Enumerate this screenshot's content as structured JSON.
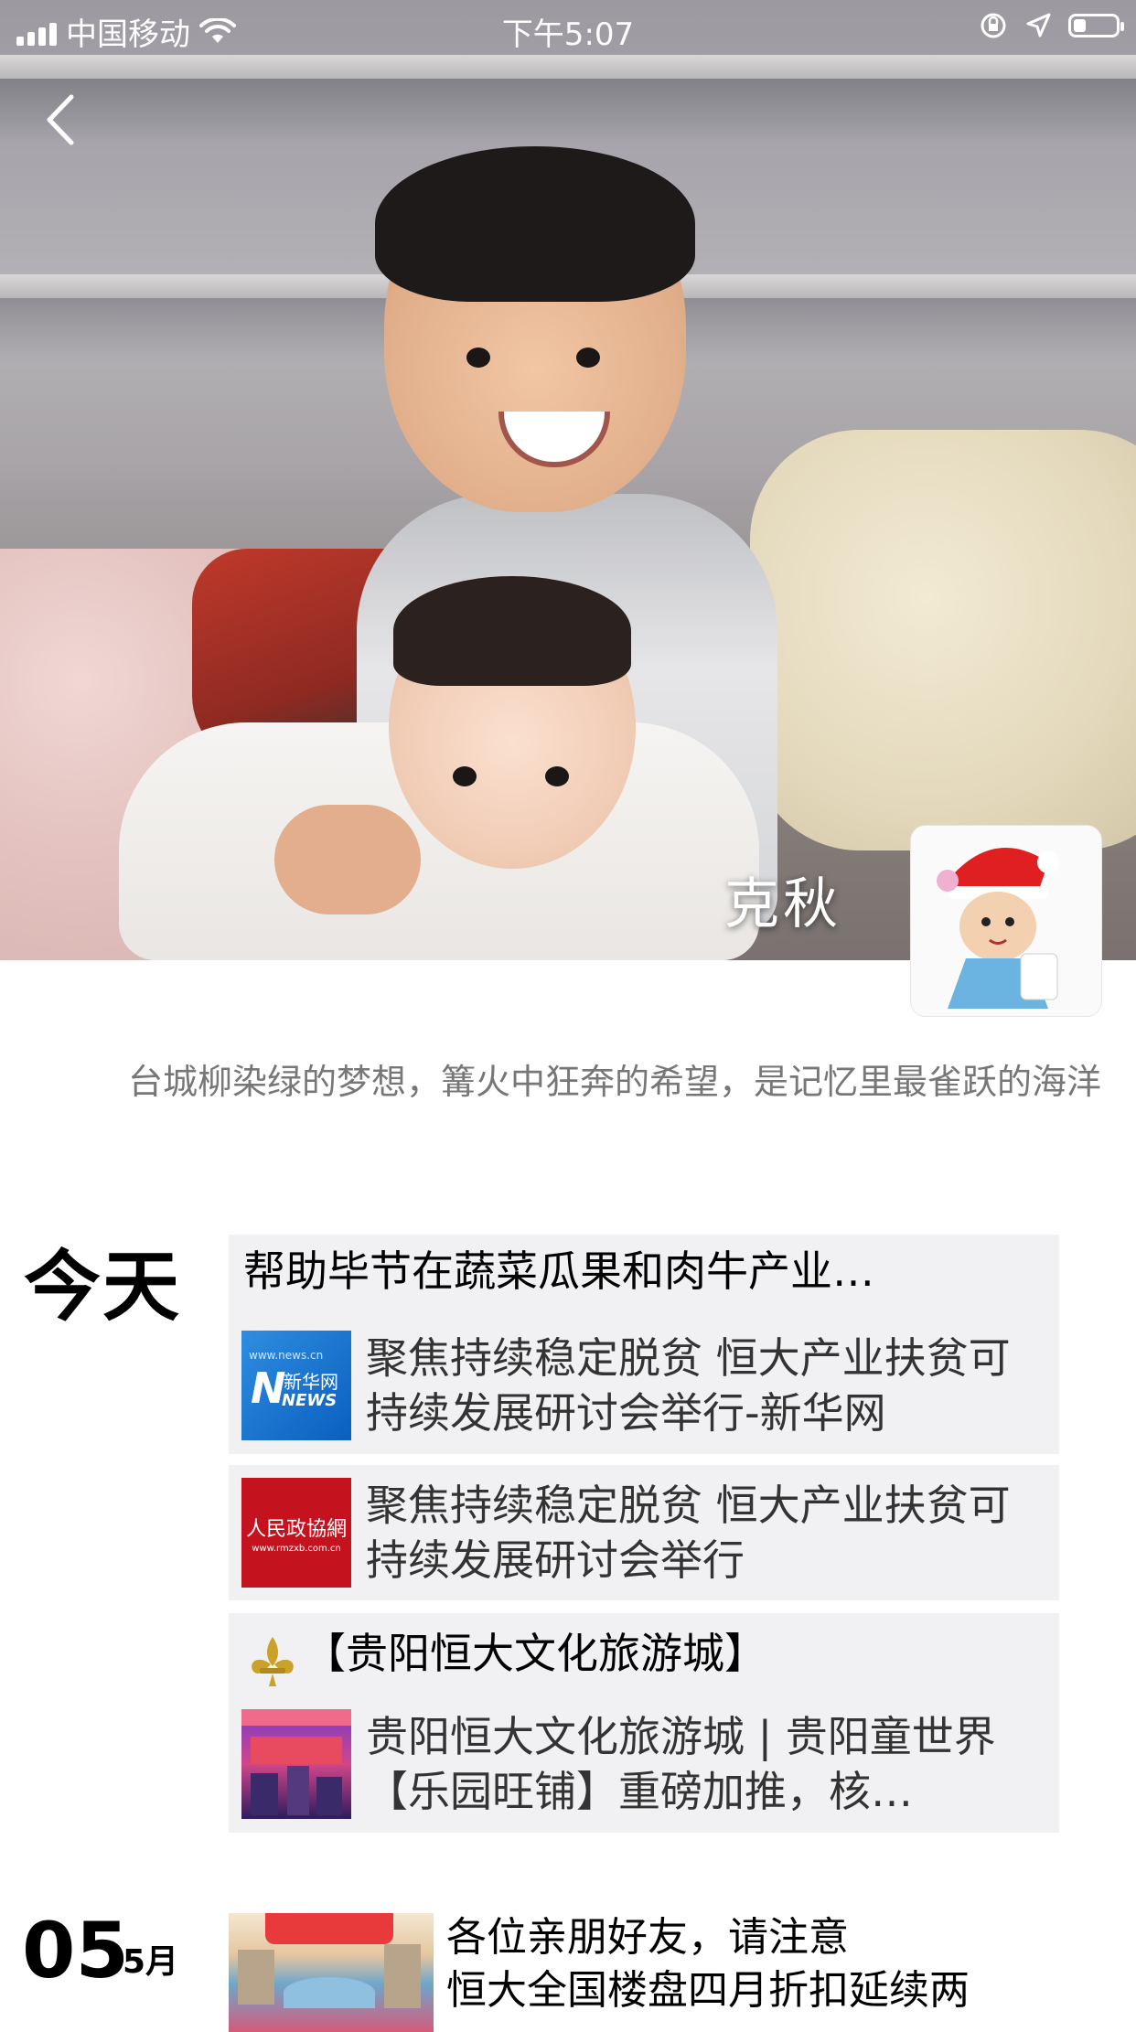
{
  "status_bar": {
    "carrier": "中国移动",
    "time": "下午5:07",
    "battery_level": 0.3
  },
  "profile": {
    "nickname": "克秋",
    "signature": "台城柳染绿的梦想，篝火中狂奔的希望，是记忆里最雀跃的海洋"
  },
  "today": {
    "label": "今天",
    "cards": [
      {
        "title": "帮助毕节在蔬菜瓜果和肉牛产业…",
        "thumb_icon": "xinhua-news-logo",
        "thumb_text": "新华网",
        "thumb_sub": "NEWS",
        "text": "聚焦持续稳定脱贫 恒大产业扶贫可持续发展研讨会举行-新华网"
      },
      {
        "thumb_icon": "rmzxb-logo",
        "thumb_text": "人民政協網",
        "thumb_sub": "www.rmzxb.com.cn",
        "text": "聚焦持续稳定脱贫 恒大产业扶贫可持续发展研讨会举行"
      },
      {
        "title": "【贵阳恒大文化旅游城】",
        "title_icon": "fleur-de-lis-icon",
        "thumb_icon": "promo-poster",
        "text": "贵阳恒大文化旅游城 | 贵阳童世界【乐园旺铺】重磅加推，核…"
      }
    ]
  },
  "older_post": {
    "day": "05",
    "month": "5月",
    "text": "各位亲朋好友，请注意\n恒大全国楼盘四月折扣延续两"
  }
}
